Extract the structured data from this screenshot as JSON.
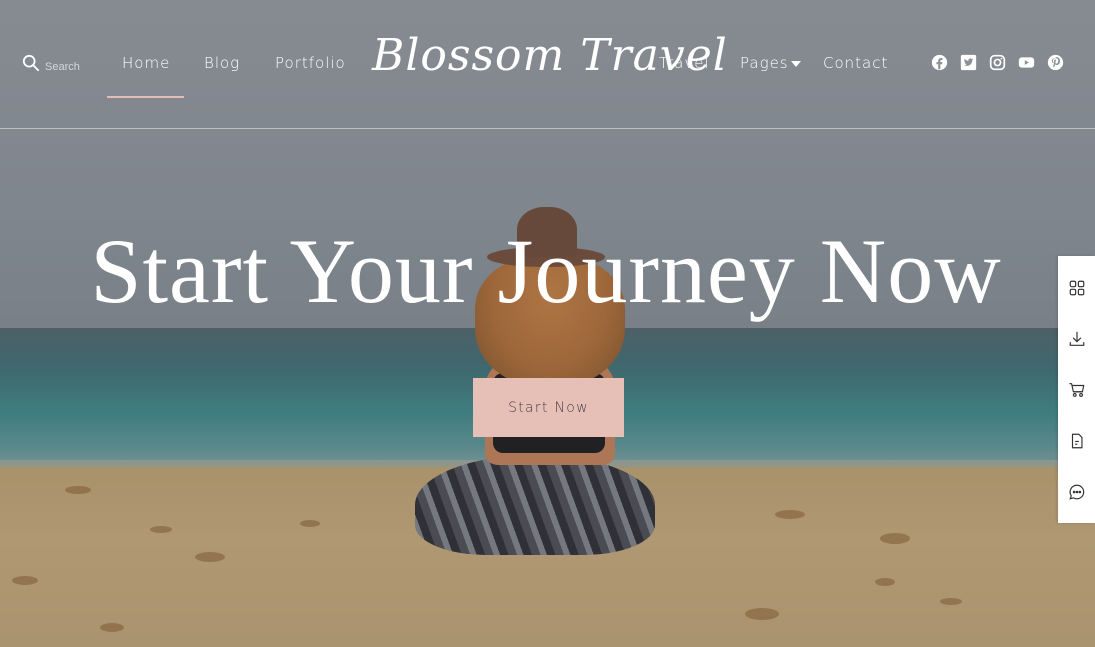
{
  "header": {
    "search_label": "Search",
    "logo": "Blossom Travel",
    "nav_left": [
      {
        "label": "Home",
        "active": true
      },
      {
        "label": "Blog"
      },
      {
        "label": "Portfolio"
      }
    ],
    "nav_right": [
      {
        "label": "Travel"
      },
      {
        "label": "Pages",
        "has_dropdown": true
      },
      {
        "label": "Contact"
      }
    ],
    "social_icons": [
      "facebook-icon",
      "twitter-icon",
      "instagram-icon",
      "youtube-icon",
      "pinterest-icon"
    ]
  },
  "hero": {
    "title": "Start Your Journey Now",
    "cta_label": "Start Now"
  },
  "toolbar": {
    "icons": [
      "grid-icon",
      "download-icon",
      "cart-icon",
      "document-icon",
      "chat-icon"
    ]
  },
  "colors": {
    "accent": "#e6c0b6",
    "underline": "#e3bdb2",
    "cta_text": "#4a3d43"
  }
}
